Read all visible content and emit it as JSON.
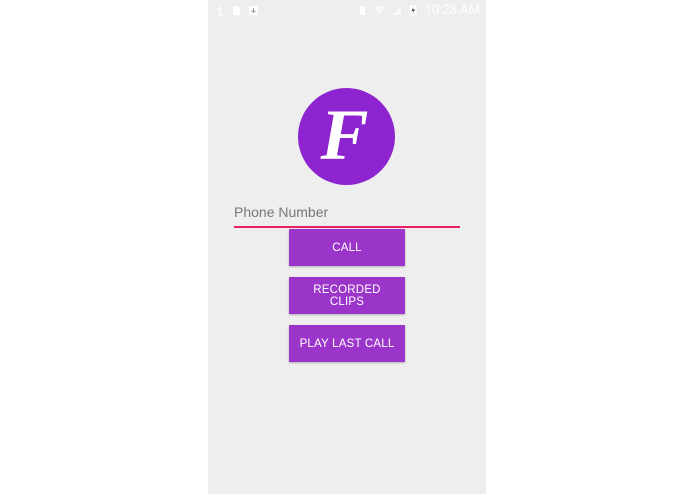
{
  "status_bar": {
    "time": "10:28 AM",
    "left_icons": [
      "usb-icon",
      "sd-card-icon",
      "download-icon"
    ],
    "right_icons": [
      "vibrate-icon",
      "wifi-icon",
      "signal-icon",
      "battery-charging-icon"
    ]
  },
  "logo": {
    "letter": "F",
    "color": "#8e24cf"
  },
  "phone_input": {
    "placeholder": "Phone Number",
    "value": ""
  },
  "buttons": {
    "call": "CALL",
    "recorded_clips": "RECORDED CLIPS",
    "play_last_call": "PLAY LAST CALL"
  },
  "colors": {
    "button": "#9b34c8",
    "underline": "#e91e63",
    "background": "#eeeeee"
  }
}
